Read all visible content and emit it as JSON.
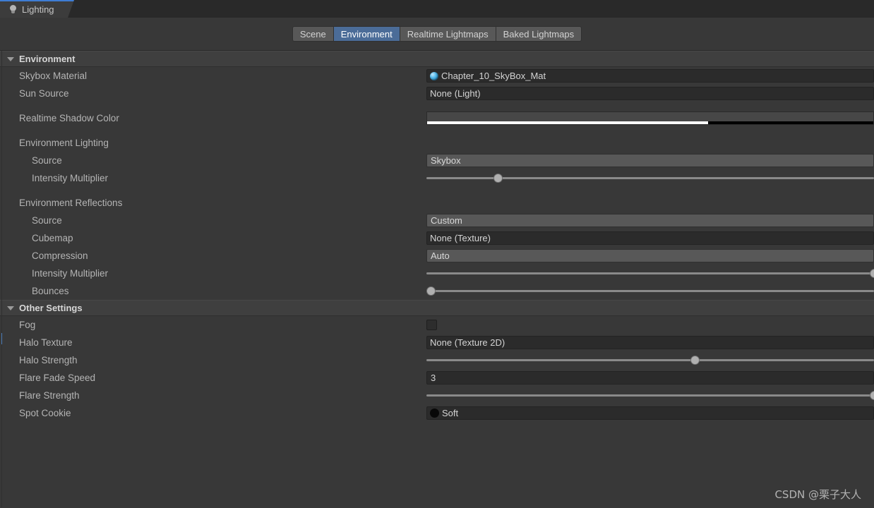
{
  "window": {
    "tab_label": "Lighting",
    "tab_icon": "lightbulb-icon"
  },
  "mode_tabs": [
    {
      "label": "Scene",
      "active": false
    },
    {
      "label": "Environment",
      "active": true
    },
    {
      "label": "Realtime Lightmaps",
      "active": false
    },
    {
      "label": "Baked Lightmaps",
      "active": false
    }
  ],
  "sections": [
    {
      "title": "Environment",
      "expanded": true,
      "rows": [
        {
          "label": "Skybox Material",
          "type": "object",
          "value": "Chapter_10_SkyBox_Mat",
          "icon": "material-sphere-icon"
        },
        {
          "label": "Sun Source",
          "type": "object",
          "value": "None (Light)",
          "icon": ""
        },
        {
          "label": "",
          "type": "spacer"
        },
        {
          "label": "Realtime Shadow Color",
          "type": "color",
          "value": "#474747",
          "alpha_percent": 63
        },
        {
          "label": "",
          "type": "spacer"
        },
        {
          "label": "Environment Lighting",
          "type": "group"
        },
        {
          "label": "Source",
          "type": "popup",
          "value": "Skybox",
          "indent": true
        },
        {
          "label": "Intensity Multiplier",
          "type": "slider",
          "knob_percent": 16,
          "indent": true
        },
        {
          "label": "",
          "type": "spacer"
        },
        {
          "label": "Environment Reflections",
          "type": "group"
        },
        {
          "label": "Source",
          "type": "popup",
          "value": "Custom",
          "indent": true
        },
        {
          "label": "Cubemap",
          "type": "object",
          "value": "None (Texture)",
          "icon": "",
          "indent": true
        },
        {
          "label": "Compression",
          "type": "popup",
          "value": "Auto",
          "indent": true
        },
        {
          "label": "Intensity Multiplier",
          "type": "slider",
          "knob_percent": 100,
          "indent": true
        },
        {
          "label": "Bounces",
          "type": "slider",
          "knob_percent": 1,
          "indent": true
        }
      ]
    },
    {
      "title": "Other Settings",
      "expanded": true,
      "rows": [
        {
          "label": "Fog",
          "type": "checkbox",
          "checked": false
        },
        {
          "label": "Halo Texture",
          "type": "object",
          "value": "None (Texture 2D)",
          "icon": ""
        },
        {
          "label": "Halo Strength",
          "type": "slider",
          "knob_percent": 60
        },
        {
          "label": "Flare Fade Speed",
          "type": "text",
          "value": "3"
        },
        {
          "label": "Flare Strength",
          "type": "slider",
          "knob_percent": 100
        },
        {
          "label": "Spot Cookie",
          "type": "object",
          "value": "Soft",
          "icon": "cookie-icon"
        }
      ]
    }
  ],
  "watermark": "CSDN @栗子大人"
}
